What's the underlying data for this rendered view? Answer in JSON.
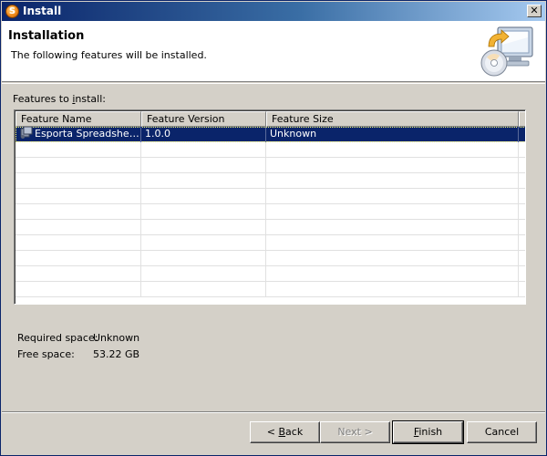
{
  "window": {
    "title": "Install",
    "app_icon_letter": "S"
  },
  "header": {
    "title": "Installation",
    "description": "The following features will be installed."
  },
  "features": {
    "label_prefix": "Features to ",
    "label_mnemonic": "i",
    "label_suffix": "nstall:",
    "columns": [
      "Feature Name",
      "Feature Version",
      "Feature Size"
    ],
    "rows": [
      {
        "name": "Esporta Spreadsheet…",
        "version": "1.0.0",
        "size": "Unknown",
        "selected": true
      }
    ]
  },
  "space": {
    "required_label": "Required space:",
    "required_value": "Unknown",
    "free_label": "Free space:",
    "free_value": "53.22 GB"
  },
  "buttons": {
    "back": {
      "prefix": "< ",
      "mnemonic": "B",
      "rest": "ack",
      "enabled": true
    },
    "next": {
      "label": "Next >",
      "enabled": false
    },
    "finish": {
      "mnemonic": "F",
      "rest": "inish",
      "enabled": true,
      "default": true
    },
    "cancel": {
      "label": "Cancel",
      "enabled": true
    }
  },
  "icons": {
    "app": "eclipse-sun-icon",
    "banner": "install-computer-cd-icon",
    "feature": "plugin-feature-icon",
    "close": "close-icon"
  }
}
